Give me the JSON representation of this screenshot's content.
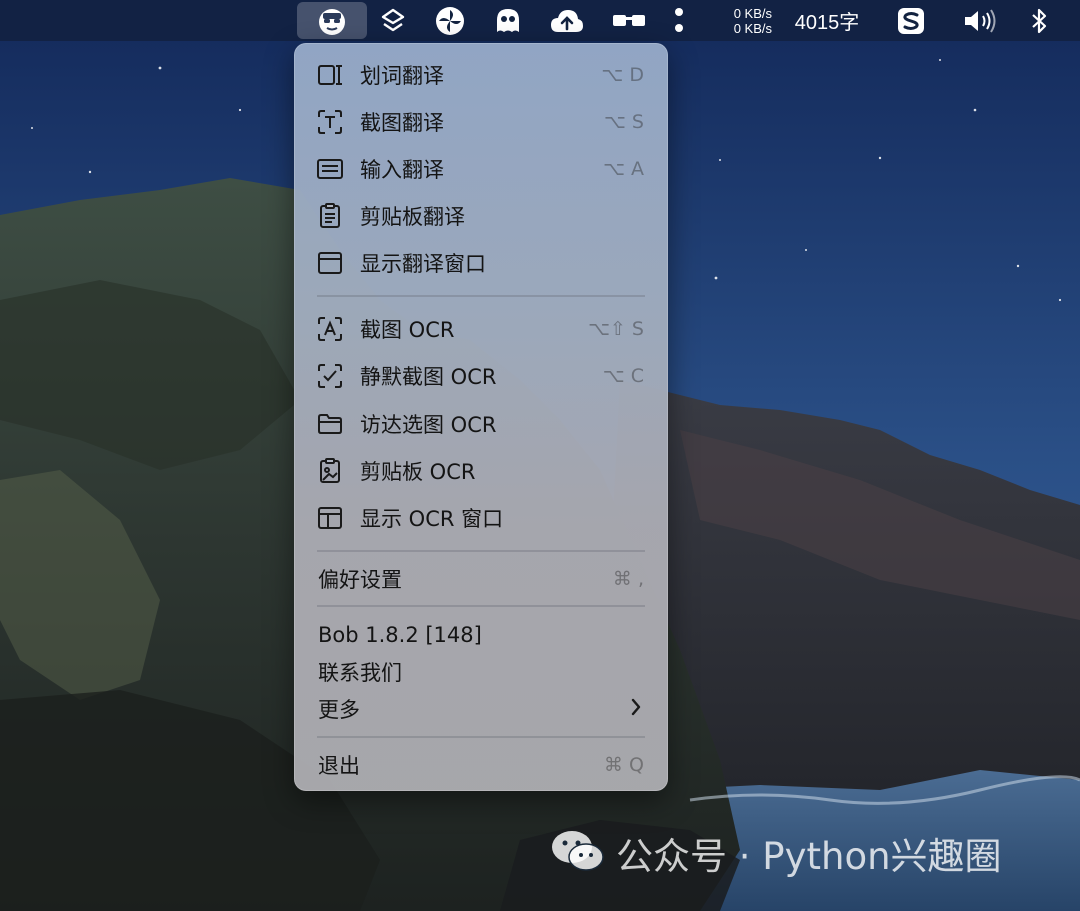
{
  "menubar": {
    "net_up": "0 KB/s",
    "net_down": "0 KB/s",
    "word_count": "4015字",
    "icons": [
      "bob-app-icon",
      "layers-icon",
      "pinwheel-icon",
      "ghost-icon",
      "cloud-upload-icon",
      "glasses-icon",
      "more-vertical-icon",
      "sogou-icon",
      "volume-icon",
      "bluetooth-icon"
    ]
  },
  "menu": {
    "translate": [
      {
        "label": "划词翻译",
        "shortcut": "⌥ D",
        "icon": "text-select-icon"
      },
      {
        "label": "截图翻译",
        "shortcut": "⌥ S",
        "icon": "screenshot-text-icon"
      },
      {
        "label": "输入翻译",
        "shortcut": "⌥ A",
        "icon": "keyboard-icon"
      },
      {
        "label": "剪贴板翻译",
        "shortcut": "",
        "icon": "clipboard-icon"
      },
      {
        "label": "显示翻译窗口",
        "shortcut": "",
        "icon": "window-icon"
      }
    ],
    "ocr": [
      {
        "label": "截图 OCR",
        "shortcut": "⌥⇧ S",
        "icon": "screenshot-ocr-icon"
      },
      {
        "label": "静默截图 OCR",
        "shortcut": "⌥ C",
        "icon": "silent-ocr-icon"
      },
      {
        "label": "访达选图 OCR",
        "shortcut": "",
        "icon": "folder-icon"
      },
      {
        "label": "剪贴板 OCR",
        "shortcut": "",
        "icon": "clipboard-image-icon"
      },
      {
        "label": "显示 OCR 窗口",
        "shortcut": "",
        "icon": "ocr-window-icon"
      }
    ],
    "preferences": {
      "label": "偏好设置",
      "shortcut": "⌘ ,"
    },
    "version": "Bob 1.8.2 [148]",
    "contact": "联系我们",
    "more": "更多",
    "quit": {
      "label": "退出",
      "shortcut": "⌘ Q"
    }
  },
  "watermark": {
    "text": "公众号 · Python兴趣圈"
  },
  "colors": {
    "menubar": "#12223f",
    "menu_text": "#141414",
    "shortcut": "#8a8a8a",
    "sky": "#1f3a66"
  }
}
